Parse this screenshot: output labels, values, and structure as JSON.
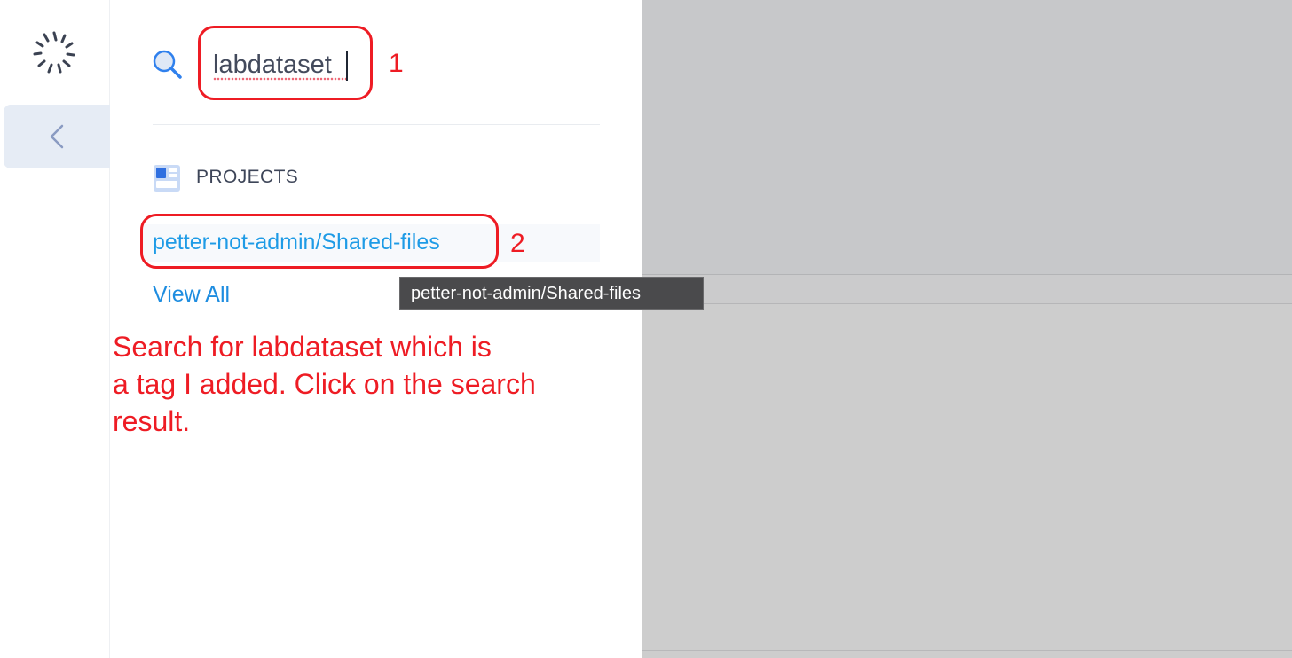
{
  "search": {
    "query": "labdataset"
  },
  "results": {
    "section_label": "PROJECTS",
    "items": [
      {
        "label": "petter-not-admin/Shared-files"
      }
    ],
    "view_all": "View All"
  },
  "tooltip": {
    "text": "petter-not-admin/Shared-files"
  },
  "annotations": {
    "step1": "1",
    "step2": "2",
    "note_lines": [
      "Search for labdataset which is",
      "a tag I added. Click on the search",
      "result."
    ]
  },
  "colors": {
    "annotation": "#ee1c24",
    "link": "#1e9be6",
    "rail_active_bg": "#e6ecf5",
    "overlay_gray": "#c7c8ca"
  },
  "icons": {
    "logo": "spinner-logo-icon",
    "collapse": "chevron-left-icon",
    "search": "search-icon",
    "projects": "projects-icon"
  }
}
